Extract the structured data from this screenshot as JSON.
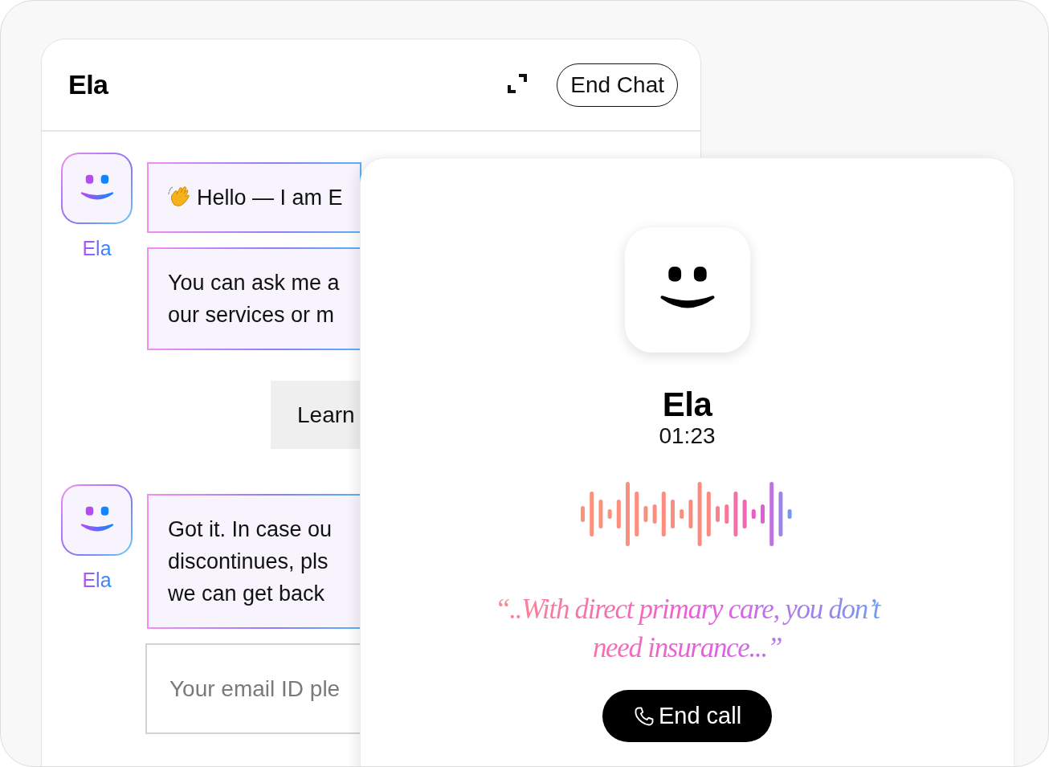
{
  "chat": {
    "title": "Ela",
    "end_button": "End Chat",
    "groups": [
      {
        "sender": "Ela",
        "items": [
          {
            "kind": "bubble",
            "wave": true,
            "lines": [
              "Hello — I am E"
            ]
          },
          {
            "kind": "bubble",
            "wave": false,
            "lines": [
              "You can ask me a",
              "our services or m"
            ]
          },
          {
            "kind": "button",
            "label": "Learn"
          }
        ]
      },
      {
        "sender": "Ela",
        "items": [
          {
            "kind": "bubble",
            "wave": false,
            "lines": [
              "Got it. In case ou",
              "discontinues, pls",
              "we can get back"
            ]
          },
          {
            "kind": "input",
            "placeholder": "Your email ID ple"
          }
        ]
      }
    ]
  },
  "call": {
    "name": "Ela",
    "timer": "01:23",
    "quote": "“..With direct primary care, you don’t need insurance...”",
    "end_button": "End call"
  }
}
